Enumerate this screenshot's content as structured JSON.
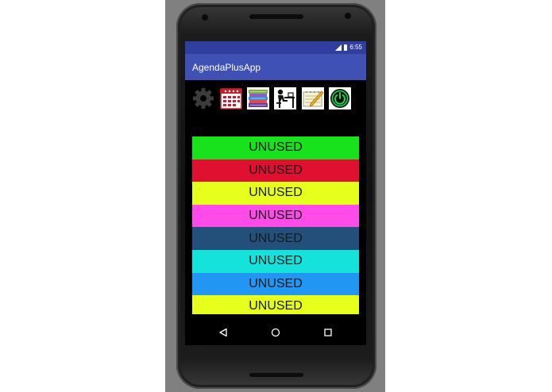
{
  "status_bar": {
    "time": "6:55",
    "icons": [
      "signal-icon",
      "battery-icon"
    ]
  },
  "app_bar": {
    "title": "AgendaPlusApp"
  },
  "toolbar": {
    "items": [
      {
        "icon": "gear-icon"
      },
      {
        "icon": "calendar-icon"
      },
      {
        "icon": "books-icon"
      },
      {
        "icon": "student-desk-icon"
      },
      {
        "icon": "notepad-pencil-icon"
      },
      {
        "icon": "power-icon"
      }
    ]
  },
  "slots": [
    {
      "label": "UNUSED",
      "color": "#18e21c"
    },
    {
      "label": "UNUSED",
      "color": "#e01030"
    },
    {
      "label": "UNUSED",
      "color": "#e6ff1c"
    },
    {
      "label": "UNUSED",
      "color": "#ff4ce8"
    },
    {
      "label": "UNUSED",
      "color": "#22507a"
    },
    {
      "label": "UNUSED",
      "color": "#16e2dc"
    },
    {
      "label": "UNUSED",
      "color": "#2196f3"
    },
    {
      "label": "UNUSED",
      "color": "#e6ff1c"
    }
  ],
  "nav_bar": {
    "buttons": [
      "back-icon",
      "home-icon",
      "recents-icon"
    ]
  }
}
